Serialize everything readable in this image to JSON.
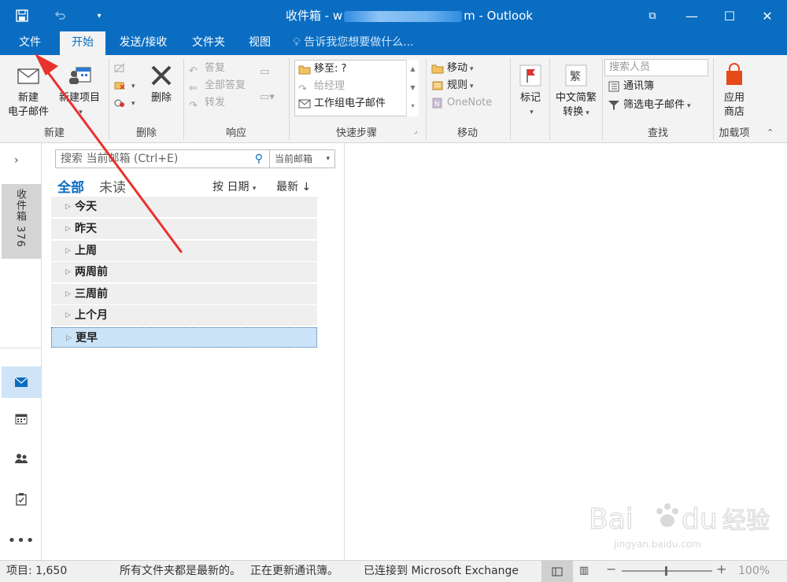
{
  "titlebar": {
    "title_left": "收件箱 - w",
    "title_right": "m - Outlook",
    "restore_glyph": "⧉",
    "minimize_glyph": "—",
    "maximize_glyph": "☐",
    "close_glyph": "✕"
  },
  "tabs": {
    "file": "文件",
    "home": "开始",
    "sendreceive": "发送/接收",
    "folder": "文件夹",
    "view": "视图",
    "tellme": "告诉我您想要做什么..."
  },
  "ribbon": {
    "new": {
      "new_email_l1": "新建",
      "new_email_l2": "电子邮件",
      "new_items": "新建项目",
      "group": "新建"
    },
    "delete": {
      "delete": "删除",
      "group": "删除"
    },
    "respond": {
      "reply": "答复",
      "reply_all": "全部答复",
      "forward": "转发",
      "group": "响应"
    },
    "quicksteps": {
      "move_to": "移至: ?",
      "to_manager": "给经理",
      "team_email": "工作组电子邮件",
      "group": "快速步骤"
    },
    "move": {
      "move": "移动",
      "rules": "规则",
      "onenote": "OneNote",
      "group": "移动"
    },
    "tags": {
      "flag": "标记"
    },
    "chinese": {
      "l1": "中文简繁",
      "l2": "转换"
    },
    "find": {
      "search_people": "搜索人员",
      "address_book": "通讯簿",
      "filter_email": "筛选电子邮件",
      "group": "查找"
    },
    "addins": {
      "store_l1": "应用",
      "store_l2": "商店",
      "group": "加载项"
    }
  },
  "nav": {
    "inbox_label": "收件箱 376"
  },
  "maillist": {
    "search_placeholder": "搜索 当前邮箱 (Ctrl+E)",
    "scope": "当前邮箱",
    "filter_all": "全部",
    "filter_unread": "未读",
    "sort_by": "按 日期",
    "sort_order": "最新 ↓",
    "groups": [
      "今天",
      "昨天",
      "上周",
      "两周前",
      "三周前",
      "上个月",
      "更早"
    ]
  },
  "status": {
    "items": "项目: 1,650",
    "folders_uptodate": "所有文件夹都是最新的。",
    "updating_addressbook": "正在更新通讯簿。",
    "connected": "已连接到 Microsoft Exchange",
    "zoom": "100%"
  },
  "watermark": {
    "brand": "Bai",
    "brand2": "du",
    "suffix": "经验",
    "url": "jingyan.baidu.com"
  },
  "colors": {
    "accent": "#0a6dc2",
    "arrow": "#e8322e"
  }
}
